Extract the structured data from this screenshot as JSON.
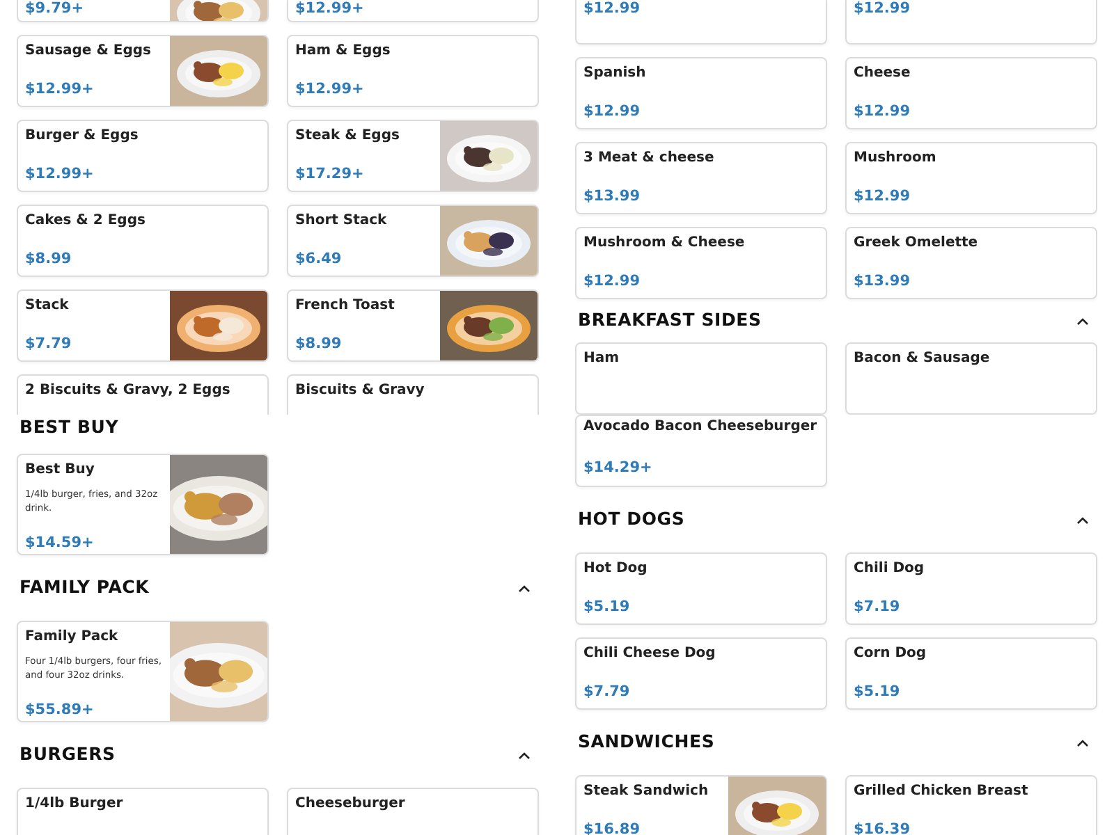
{
  "columns": [
    {
      "top_pane": [
        {
          "kind": "items",
          "items": [
            {
              "price": "$9.79+",
              "photo": true
            },
            {
              "price": "$12.99+"
            }
          ]
        },
        {
          "kind": "items",
          "items": [
            {
              "name": "Sausage & Eggs",
              "price": "$12.99+",
              "photo": true
            },
            {
              "name": "Ham & Eggs",
              "price": "$12.99+"
            }
          ]
        },
        {
          "kind": "items",
          "items": [
            {
              "name": "Burger & Eggs",
              "price": "$12.99+"
            },
            {
              "name": "Steak & Eggs",
              "price": "$17.29+",
              "photo": true
            }
          ]
        },
        {
          "kind": "items",
          "items": [
            {
              "name": "Cakes & 2 Eggs",
              "price": "$8.99"
            },
            {
              "name": "Short Stack",
              "price": "$6.49",
              "photo": true
            }
          ]
        },
        {
          "kind": "items",
          "items": [
            {
              "name": "Stack",
              "price": "$7.79",
              "photo": true
            },
            {
              "name": "French Toast",
              "price": "$8.99",
              "photo": true
            }
          ]
        },
        {
          "kind": "items",
          "items": [
            {
              "name": "2 Biscuits & Gravy, 2 Eggs"
            },
            {
              "name": "Biscuits & Gravy"
            }
          ]
        }
      ],
      "bottom_pane": [
        {
          "kind": "heading",
          "title": "BEST BUY"
        },
        {
          "kind": "items",
          "items": [
            {
              "name": "Best Buy",
              "description": "1/4lb burger, fries, and 32oz drink.",
              "price": "$14.59+",
              "photo": true
            }
          ]
        },
        {
          "kind": "heading",
          "title": "FAMILY PACK",
          "expanded": true
        },
        {
          "kind": "items",
          "items": [
            {
              "name": "Family Pack",
              "description": "Four 1/4lb burgers, four fries, and four 32oz drinks.",
              "price": "$55.89+",
              "photo": true
            }
          ]
        },
        {
          "kind": "heading",
          "title": "BURGERS",
          "expanded": true
        },
        {
          "kind": "items",
          "items": [
            {
              "name": "1/4lb Burger"
            },
            {
              "name": "Cheeseburger"
            }
          ]
        }
      ]
    },
    {
      "top_pane": [
        {
          "kind": "items",
          "items": [
            {
              "price": "$12.99"
            },
            {
              "price": "$12.99"
            }
          ]
        },
        {
          "kind": "items",
          "items": [
            {
              "name": "Spanish",
              "price": "$12.99"
            },
            {
              "name": "Cheese",
              "price": "$12.99"
            }
          ]
        },
        {
          "kind": "items",
          "items": [
            {
              "name": "3 Meat & cheese",
              "price": "$13.99"
            },
            {
              "name": "Mushroom",
              "price": "$12.99"
            }
          ]
        },
        {
          "kind": "items",
          "items": [
            {
              "name": "Mushroom & Cheese",
              "price": "$12.99"
            },
            {
              "name": "Greek Omelette",
              "price": "$13.99"
            }
          ]
        },
        {
          "kind": "heading",
          "title": "BREAKFAST SIDES",
          "expanded": true
        },
        {
          "kind": "items",
          "items": [
            {
              "name": "Ham"
            },
            {
              "name": "Bacon & Sausage"
            }
          ]
        }
      ],
      "bottom_pane": [
        {
          "kind": "items",
          "items": [
            {
              "name": "Avocado Bacon Cheeseburger",
              "price": "$14.29+"
            }
          ]
        },
        {
          "kind": "heading",
          "title": "HOT DOGS",
          "expanded": true
        },
        {
          "kind": "items",
          "items": [
            {
              "name": "Hot Dog",
              "price": "$5.19"
            },
            {
              "name": "Chili Dog",
              "price": "$7.19"
            }
          ]
        },
        {
          "kind": "items",
          "items": [
            {
              "name": "Chili Cheese Dog",
              "price": "$7.79"
            },
            {
              "name": "Corn Dog",
              "price": "$5.19"
            }
          ]
        },
        {
          "kind": "heading",
          "title": "SANDWICHES",
          "expanded": true
        },
        {
          "kind": "items",
          "items": [
            {
              "name": "Steak Sandwich",
              "price": "$16.89",
              "photo": true
            },
            {
              "name": "Grilled Chicken Breast",
              "price": "$16.39"
            }
          ]
        }
      ]
    }
  ]
}
